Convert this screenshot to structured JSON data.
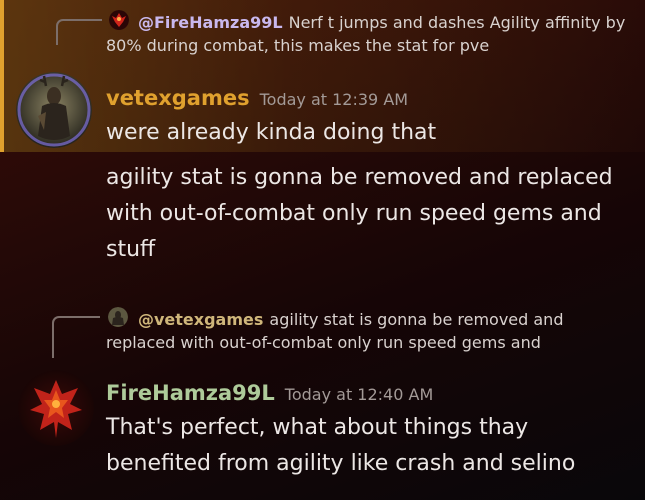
{
  "message1": {
    "reply": {
      "mention": "@FireHamza99L",
      "text": "Nerf t jumps and dashes Agility affinity by 80% during combat, this makes the stat for pve"
    },
    "username": "vetexgames",
    "timestamp": "Today at 12:39 AM",
    "username_color": "#e0a12e",
    "lines": [
      "were already kinda doing that",
      "agility stat is gonna be removed and replaced with out-of-combat only run speed gems and stuff"
    ]
  },
  "message2": {
    "reply": {
      "mention": "@vetexgames",
      "text": "agility stat is gonna be removed and replaced with out-of-combat only run speed gems and"
    },
    "username": "FireHamza99L",
    "timestamp": "Today at 12:40 AM",
    "username_color": "#aecb9a",
    "lines": [
      "That's perfect, what about things thay benefited from agility like crash and selino"
    ]
  },
  "colors": {
    "highlight_border": "#e0a12e",
    "background": "#240907"
  }
}
